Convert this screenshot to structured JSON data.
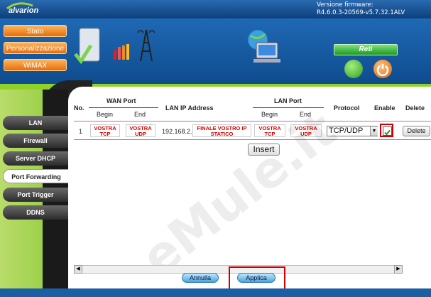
{
  "brand": {
    "logo_text": "alvarion"
  },
  "firmware": {
    "label": "Versione firmware:",
    "version": "R4.6.0.3-20569-v5.7.32.1ALV"
  },
  "top_nav": [
    {
      "label": "Stato"
    },
    {
      "label": "Personalizzazione"
    },
    {
      "label": "WiMAX"
    }
  ],
  "header": {
    "reti_label": "Reti"
  },
  "sidebar": {
    "items": [
      {
        "label": "LAN"
      },
      {
        "label": "Firewall"
      },
      {
        "label": "Server DHCP"
      },
      {
        "label": "Port Forwarding",
        "active": true
      },
      {
        "label": "Port Trigger"
      },
      {
        "label": "DDNS"
      }
    ]
  },
  "table": {
    "headers": {
      "no": "No.",
      "wan_port": "WAN Port",
      "lan_ip": "LAN IP Address",
      "lan_port": "LAN Port",
      "protocol": "Protocol",
      "enable": "Enable",
      "delete": "Delete",
      "begin": "Begin",
      "end": "End"
    },
    "row": {
      "no": "1",
      "wan_begin": "VOSTRA TCP",
      "wan_end": "VOSTRA UDP",
      "ip_prefix": "192.168.2.",
      "ip_last": "FINALE VOSTRO IP STATICO",
      "lan_begin": "VOSTRA TCP",
      "lan_end": "VOSTRA UDP",
      "protocol": "TCP/UDP",
      "enabled": true,
      "delete_label": "Delete"
    },
    "insert_label": "Insert"
  },
  "actions": {
    "cancel_label": "Annulla",
    "apply_label": "Applica"
  },
  "watermark": "eMule.it",
  "colors": {
    "nav_orange": "#e46e0b",
    "accent_green": "#8fd128",
    "highlight_red": "#d00000",
    "header_blue": "#1f69b4"
  }
}
